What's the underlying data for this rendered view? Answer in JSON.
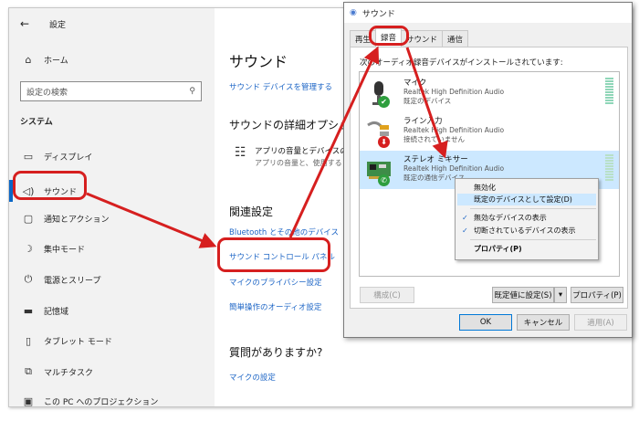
{
  "settings": {
    "app_title": "設定",
    "back_glyph": "←",
    "nav": {
      "home": "ホーム",
      "search_placeholder": "設定の検索",
      "section": "システム",
      "items": [
        {
          "icon": "monitor-icon",
          "glyph": "▭",
          "label": "ディスプレイ"
        },
        {
          "icon": "speaker-icon",
          "glyph": "🔈",
          "label": "サウンド"
        },
        {
          "icon": "notification-icon",
          "glyph": "▢",
          "label": "通知とアクション"
        },
        {
          "icon": "moon-icon",
          "glyph": "☽",
          "label": "集中モード"
        },
        {
          "icon": "power-icon",
          "glyph": "⏻",
          "label": "電源とスリープ"
        },
        {
          "icon": "storage-icon",
          "glyph": "▬",
          "label": "記憶域"
        },
        {
          "icon": "tablet-icon",
          "glyph": "▯",
          "label": "タブレット モード"
        },
        {
          "icon": "multitask-icon",
          "glyph": "⧉",
          "label": "マルチタスク"
        },
        {
          "icon": "project-icon",
          "glyph": "▣",
          "label": "この PC へのプロジェクション"
        }
      ]
    },
    "content": {
      "title": "サウンド",
      "manage_devices_link": "サウンド デバイスを管理する",
      "advanced_heading": "サウンドの詳細オプション",
      "app_volume_title": "アプリの音量とデバイスの",
      "app_volume_sub": "アプリの音量と、使用する",
      "related_heading": "関連設定",
      "bluetooth_link": "Bluetooth とその他のデバイス",
      "sound_control_panel_link": "サウンド コントロール パネル",
      "mic_privacy_link": "マイクのプライバシー設定",
      "ease_audio_link": "簡単操作のオーディオ設定",
      "question_heading": "質問がありますか?",
      "mic_settings_link": "マイクの設定"
    }
  },
  "dialog": {
    "title": "サウンド",
    "tabs": [
      "再生",
      "録音",
      "サウンド",
      "通信"
    ],
    "active_tab": "録音",
    "description": "次のオーディオ録音デバイスがインストールされています:",
    "devices": [
      {
        "name": "マイク",
        "driver": "Realtek High Definition Audio",
        "status": "既定のデバイス",
        "icon": "microphone-icon",
        "badge": "✔",
        "badge_color": "#2e9e3e"
      },
      {
        "name": "ライン入力",
        "driver": "Realtek High Definition Audio",
        "status": "接続されていません",
        "icon": "line-in-icon",
        "badge": "⬇",
        "badge_color": "#d61f1f"
      },
      {
        "name": "ステレオ ミキサー",
        "driver": "Realtek High Definition Audio",
        "status": "既定の通信デバイス",
        "icon": "sound-card-icon",
        "badge": "✆",
        "badge_color": "#2e9e3e"
      }
    ],
    "buttons": {
      "configure": "構成(C)",
      "set_default": "既定値に設定(S)",
      "properties": "プロパティ(P)",
      "ok": "OK",
      "cancel": "キャンセル",
      "apply": "適用(A)"
    }
  },
  "context_menu": {
    "items": [
      {
        "label": "無効化",
        "checked": false
      },
      {
        "label": "既定のデバイスとして設定(D)",
        "checked": false
      },
      {
        "label": "無効なデバイスの表示",
        "checked": true
      },
      {
        "label": "切断されているデバイスの表示",
        "checked": true
      },
      {
        "label": "プロパティ(P)",
        "checked": false
      }
    ]
  },
  "colors": {
    "accent": "#0a66c6",
    "link": "#1e66c6",
    "annotation": "#d61f1f",
    "selection": "#cce8ff"
  }
}
